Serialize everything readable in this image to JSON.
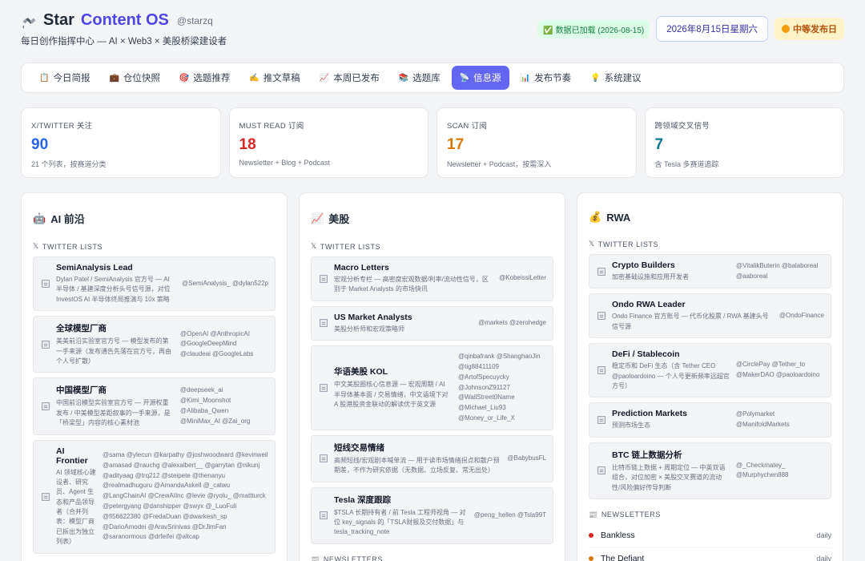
{
  "header": {
    "brand_a": "Star",
    "brand_b": "Content OS",
    "handle": "@starzq",
    "tagline": "每日创作指挥中心 — AI × Web3 × 美股桥梁建设者",
    "data_loaded": "✅ 数据已加载 (2026-08-15)",
    "date": "2026年8月15日星期六",
    "publish_level": "中等发布日",
    "colors": {
      "accent": "#6366f1",
      "brand": "#4f46e5"
    }
  },
  "tabs": [
    {
      "icon": "clipboard-icon",
      "label": "今日简报"
    },
    {
      "icon": "briefcase-icon",
      "label": "仓位快照"
    },
    {
      "icon": "target-icon",
      "label": "选题推荐"
    },
    {
      "icon": "pen-icon",
      "label": "推文草稿"
    },
    {
      "icon": "chart-icon",
      "label": "本周已发布"
    },
    {
      "icon": "books-icon",
      "label": "选题库"
    },
    {
      "icon": "satellite-icon",
      "label": "信息源",
      "active": true
    },
    {
      "icon": "bar-chart-icon",
      "label": "发布节奏"
    },
    {
      "icon": "bulb-icon",
      "label": "系统建议"
    }
  ],
  "stats": [
    {
      "label": "X/TWITTER 关注",
      "value": "90",
      "desc": "21 个列表，按赛道分类",
      "color": "#2563eb"
    },
    {
      "label": "MUST READ 订阅",
      "value": "18",
      "desc": "Newsletter + Blog + Podcast",
      "color": "#dc2626"
    },
    {
      "label": "SCAN 订阅",
      "value": "17",
      "desc": "Newsletter + Podcast，按需深入",
      "color": "#d97706"
    },
    {
      "label": "跨领域交叉信号",
      "value": "7",
      "desc": "含 Tesla 多赛道追踪",
      "color": "#0e7490"
    }
  ],
  "columns": [
    {
      "icon": "robot-icon",
      "title": "AI 前沿",
      "twitter_label": "TWITTER LISTS",
      "items": [
        {
          "name": "SemiAnalysis Lead",
          "desc": "Dylan Patel / SemiAnalysis 官方号 — AI 半导体 / 基建深度分析头号信号源，对位 InvestOS AI 半导体终局推演与 10x 策略",
          "acc": "@SemiAnalysis_ @dylan522p"
        },
        {
          "name": "全球模型厂商",
          "desc": "美美前沿实验室官方号 — 模型发布的第一手来源（发布通告先落在官方号，再由个人号扩散）",
          "acc": "@OpenAI @AnthropicAI @GoogleDeepMind @claudeai @GoogleLabs"
        },
        {
          "name": "中国模型厂商",
          "desc": "中国前沿模型实验室官方号 — 开源权重发布 / 中美模型差距叙事的一手来源，是「桥梁型」内容的核心素材池",
          "acc": "@deepseek_ai @Kimi_Moonshot @Alibaba_Qwen @MiniMax_AI @Zai_org"
        },
        {
          "name": "AI Frontier",
          "desc": "AI 领域核心建设者、研究员、Agent 生态和产品领导者（合并列表：模型厂商已拆出为独立列表）",
          "acc": "@sama @ylecun @karpathy @joshwoodward @kevinweil @amasad @rauchg @alexalbert__ @garrytan @nikunj @adityaag @trq212 @steipete @thenanyu @realmadhuguru @AmandaAskell @_catwu @LangChainAI @CrewAIInc @levie @ryolu_ @mattturck @petergyang @danshipper @swyx @_LuoFuli @fi56622380 @FredaDuan @dwarkesh_sp @DarioAmodei @AravSrinivas @DrJimFan @saranormous @drfeifei @altcap"
        }
      ],
      "newsletters_label": "",
      "newsletters": []
    },
    {
      "icon": "trend-icon",
      "title": "美股",
      "twitter_label": "TWITTER LISTS",
      "items": [
        {
          "name": "Macro Letters",
          "desc": "宏观分析专栏 — 高密度宏观数据/利率/流动性信号，区别于 Market Analysts 的市场快讯",
          "acc": "@KobeissiLetter"
        },
        {
          "name": "US Market Analysts",
          "desc": "美股分析师和宏观策略师",
          "acc": "@markets @zerohedge"
        },
        {
          "name": "华语美股 KOL",
          "desc": "中文美股圈核心信息源 — 宏观周期 / AI 半导体基本面 / 交易情绪，中文语境下对 A 股港股资金联动的解读优于英文源",
          "acc": "@qinbafrank @ShanghaoJin @tig88411109 @ArtofSpecuycky @JohnsonZ91127 @WallStreet0Name @Michael_Liu93 @Money_or_Life_X"
        },
        {
          "name": "短线交易情绪",
          "desc": "高频短线/宏观剧本喊单流 — 用于读市场情绪拐点和散户预期差，不作为研究依据（无数据、立场反复、常无出处）",
          "acc": "@BabybusFL"
        },
        {
          "name": "Tesla 深度跟踪",
          "desc": "$TSLA 长期持有者 / 前 Tesla 工程师视角 — 对位 key_signals 的「TSLA财报及交付数据」与 tesla_tracking_note",
          "acc": "@peng_hellen @Tsla99T"
        }
      ],
      "newsletters_label": "NEWSLETTERS",
      "newsletters": []
    },
    {
      "icon": "moneybag-icon",
      "title": "RWA",
      "twitter_label": "TWITTER LISTS",
      "items": [
        {
          "name": "Crypto Builders",
          "desc": "加密基础设施和应用开发者",
          "acc": "@VitalikButerin @balaboreal @aaboreal"
        },
        {
          "name": "Ondo RWA Leader",
          "desc": "Ondo Finance 官方账号 — 代币化股票 / RWA 基建头号信号源",
          "acc": "@OndoFinance"
        },
        {
          "name": "DeFi / Stablecoin",
          "desc": "稳定币和 DeFi 生态（含 Tether CEO @paoloardoino — 个人号更新频率远超官方号）",
          "acc": "@CirclePay @Tether_to @MakerDAO @paoloardoino"
        },
        {
          "name": "Prediction Markets",
          "desc": "预测市场生态",
          "acc": "@Polymarket @ManifoldMarkets"
        },
        {
          "name": "BTC 链上数据分析",
          "desc": "比特币链上数据 + 周期定位 — 中英双语组合，对位加密 × 美股交叉赛道的流动性/风险偏好传导判断",
          "acc": "@_Checkmatey_ @Murphychen888"
        }
      ],
      "newsletters_label": "NEWSLETTERS",
      "newsletters": [
        {
          "name": "Bankless",
          "freq": "daily",
          "color": "#dc2626"
        },
        {
          "name": "The Defiant",
          "freq": "daily",
          "color": "#d97706"
        }
      ]
    }
  ]
}
